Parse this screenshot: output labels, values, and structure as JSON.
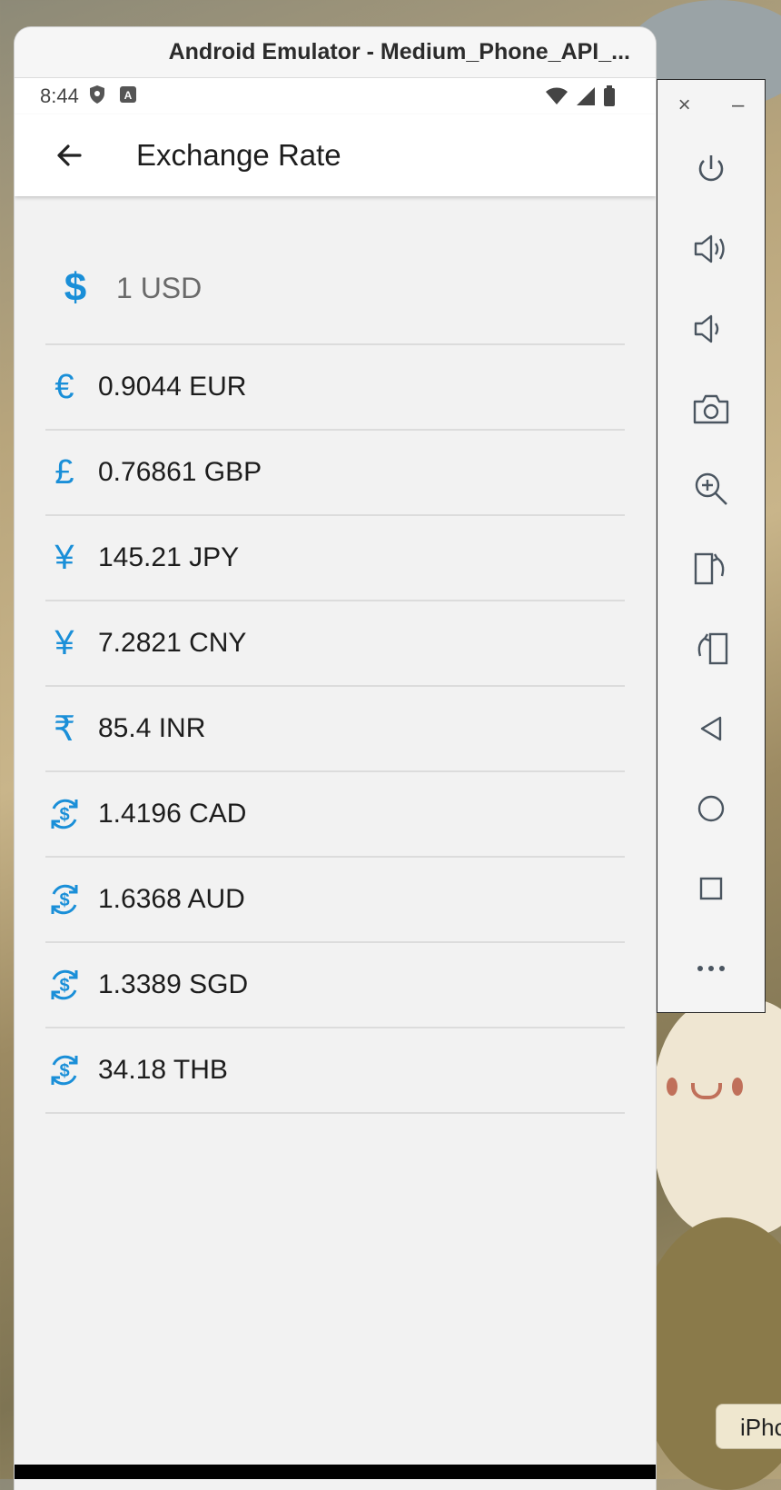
{
  "window": {
    "title": "Android Emulator - Medium_Phone_API_..."
  },
  "status_bar": {
    "time": "8:44"
  },
  "app_bar": {
    "title": "Exchange Rate"
  },
  "base": {
    "symbol": "$",
    "text": "1 USD"
  },
  "accent_color": "#1a8fd8",
  "rates": [
    {
      "symbol": "€",
      "icon": "euro-icon",
      "text": "0.9044 EUR"
    },
    {
      "symbol": "£",
      "icon": "pound-icon",
      "text": "0.76861 GBP"
    },
    {
      "symbol": "¥",
      "icon": "yen-icon",
      "text": "145.21 JPY"
    },
    {
      "symbol": "¥",
      "icon": "yuan-icon",
      "text": "7.2821 CNY"
    },
    {
      "symbol": "₹",
      "icon": "rupee-icon",
      "text": "85.4 INR"
    },
    {
      "symbol": "",
      "icon": "currency-exchange-icon",
      "text": "1.4196 CAD"
    },
    {
      "symbol": "",
      "icon": "currency-exchange-icon",
      "text": "1.6368 AUD"
    },
    {
      "symbol": "",
      "icon": "currency-exchange-icon",
      "text": "1.3389 SGD"
    },
    {
      "symbol": "",
      "icon": "currency-exchange-icon",
      "text": "34.18 THB"
    }
  ],
  "side_panel": {
    "close": "×",
    "minimize": "–",
    "buttons": [
      "power-icon",
      "volume-up-icon",
      "volume-down-icon",
      "camera-icon",
      "zoom-icon",
      "rotate-left-icon",
      "rotate-right-icon",
      "back-icon",
      "home-icon",
      "overview-icon",
      "more-icon"
    ]
  },
  "desktop": {
    "partial_button": "iPhc"
  }
}
